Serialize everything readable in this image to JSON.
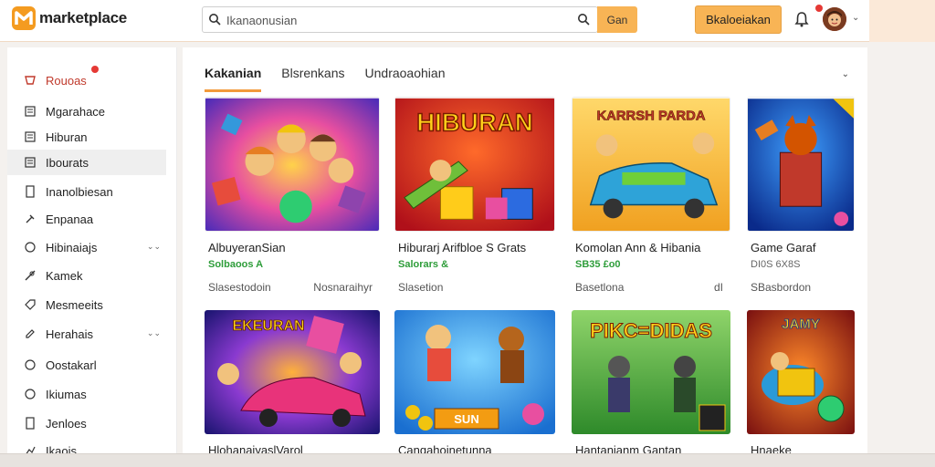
{
  "header": {
    "logo_text": "marketplace",
    "search_placeholder": "Ikanaonusian",
    "search_button": "Gan",
    "cta_button": "Bkaloeiakan"
  },
  "sidebar": {
    "items": [
      {
        "label": "Rouoas",
        "icon": "cart-icon"
      },
      {
        "label": "Mgarahace",
        "icon": "list-icon"
      },
      {
        "label": "Hiburan",
        "icon": "list-icon"
      },
      {
        "label": "Ibourats",
        "icon": "list-icon"
      },
      {
        "label": "Inanolbiesan",
        "icon": "document-icon"
      },
      {
        "label": "Enpanaa",
        "icon": "hammer-icon"
      },
      {
        "label": "Hibinaiajs",
        "icon": "circle-icon"
      },
      {
        "label": "Kamek",
        "icon": "tools-icon"
      },
      {
        "label": "Mesmeeits",
        "icon": "tag-icon"
      },
      {
        "label": "Herahais",
        "icon": "edit-icon"
      },
      {
        "label": "Oostakarl",
        "icon": "circle-icon"
      },
      {
        "label": "Ikiumas",
        "icon": "circle-icon"
      },
      {
        "label": "Jenloes",
        "icon": "document-icon"
      },
      {
        "label": "Ikaois",
        "icon": "chart-icon"
      }
    ]
  },
  "tabs": [
    "Kakanian",
    "Blsrenkans",
    "Undraoaohian"
  ],
  "cards": [
    {
      "title": "AlbuyeranSian",
      "price": "Solbaoos A",
      "meta_left": "Slasestodoin",
      "meta_right": "Nosnaraihyr",
      "price_color": "#2e9d3a",
      "art_text": ""
    },
    {
      "title": "Hiburarj Arifbloe S Grats",
      "price": "Salorars &",
      "meta_left": "Slasetion",
      "meta_right": "",
      "price_color": "#2e9d3a",
      "art_text": "HIBURAN"
    },
    {
      "title": "Komolan Ann & Hibania",
      "price": "SB35 £o0",
      "meta_left": "Basetlona",
      "meta_right": "dI",
      "price_color": "#2e9d3a",
      "art_text": "KARRSH PARDA"
    },
    {
      "title": "Game Garaf",
      "price": "DI0S 6X8S",
      "meta_left": "SBasbordon",
      "meta_right": "",
      "price_color": "#666666",
      "art_text": ""
    }
  ],
  "cards_row2": [
    {
      "title": "HlohanaiyaslVarol",
      "art_text": "EKEURAN"
    },
    {
      "title": "Canqahoinetunna",
      "art_text": "SUN"
    },
    {
      "title": "Hantanianm Gantan",
      "art_text": "PIKC=DIDAS"
    },
    {
      "title": "Hnaeke",
      "art_text": "JAMY"
    }
  ],
  "colors": {
    "accent": "#f8b455",
    "tab_underline": "#f29a3b",
    "price_green": "#2e9d3a",
    "active_red": "#c0392b"
  }
}
